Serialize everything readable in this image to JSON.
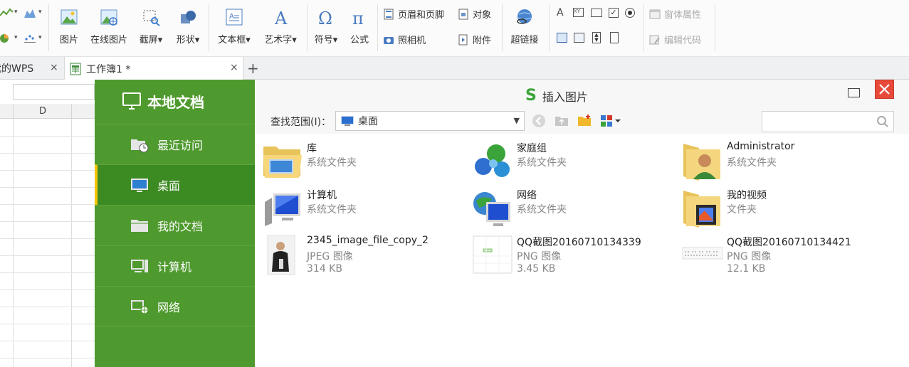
{
  "ribbon": {
    "buttons": [
      {
        "label": "图片"
      },
      {
        "label": "在线图片"
      },
      {
        "label": "截屏▾"
      },
      {
        "label": "形状▾"
      },
      {
        "label": "文本框▾"
      },
      {
        "label": "艺术字▾"
      },
      {
        "label": "符号▾"
      },
      {
        "label": "公式"
      },
      {
        "label": "超链接"
      }
    ],
    "small": {
      "header_footer": "页眉和页脚",
      "object": "对象",
      "camera": "照相机",
      "attachment": "附件",
      "window_props": "窗体属性",
      "edit_code": "编辑代码"
    }
  },
  "tabs": {
    "first": "我的WPS",
    "second": "工作簿1 *",
    "close": "×",
    "add": "+"
  },
  "sheet": {
    "column": "D"
  },
  "dialog": {
    "title": "插入图片",
    "logo_char": "S",
    "look_in_label": "查找范围(I)：",
    "look_in_value": "桌面",
    "sidebar": {
      "title": "本地文档",
      "items": [
        {
          "label": "最近访问"
        },
        {
          "label": "桌面"
        },
        {
          "label": "我的文档"
        },
        {
          "label": "计算机"
        },
        {
          "label": "网络"
        }
      ]
    },
    "files": [
      {
        "name": "库",
        "type": "系统文件夹",
        "size": ""
      },
      {
        "name": "家庭组",
        "type": "系统文件夹",
        "size": ""
      },
      {
        "name": "Administrator",
        "type": "系统文件夹",
        "size": ""
      },
      {
        "name": "计算机",
        "type": "系统文件夹",
        "size": ""
      },
      {
        "name": "网络",
        "type": "系统文件夹",
        "size": ""
      },
      {
        "name": "我的视频",
        "type": "文件夹",
        "size": ""
      },
      {
        "name": "2345_image_file_copy_2",
        "type": "JPEG 图像",
        "size": "314 KB"
      },
      {
        "name": "QQ截图20160710134339",
        "type": "PNG 图像",
        "size": "3.45 KB"
      },
      {
        "name": "QQ截图20160710134421",
        "type": "PNG 图像",
        "size": "12.1 KB"
      }
    ]
  },
  "colors": {
    "sidebar_green": "#4f9a2e",
    "active_green": "#3c8a22",
    "active_bar": "#f5c400",
    "close_red": "#e84a3a"
  }
}
